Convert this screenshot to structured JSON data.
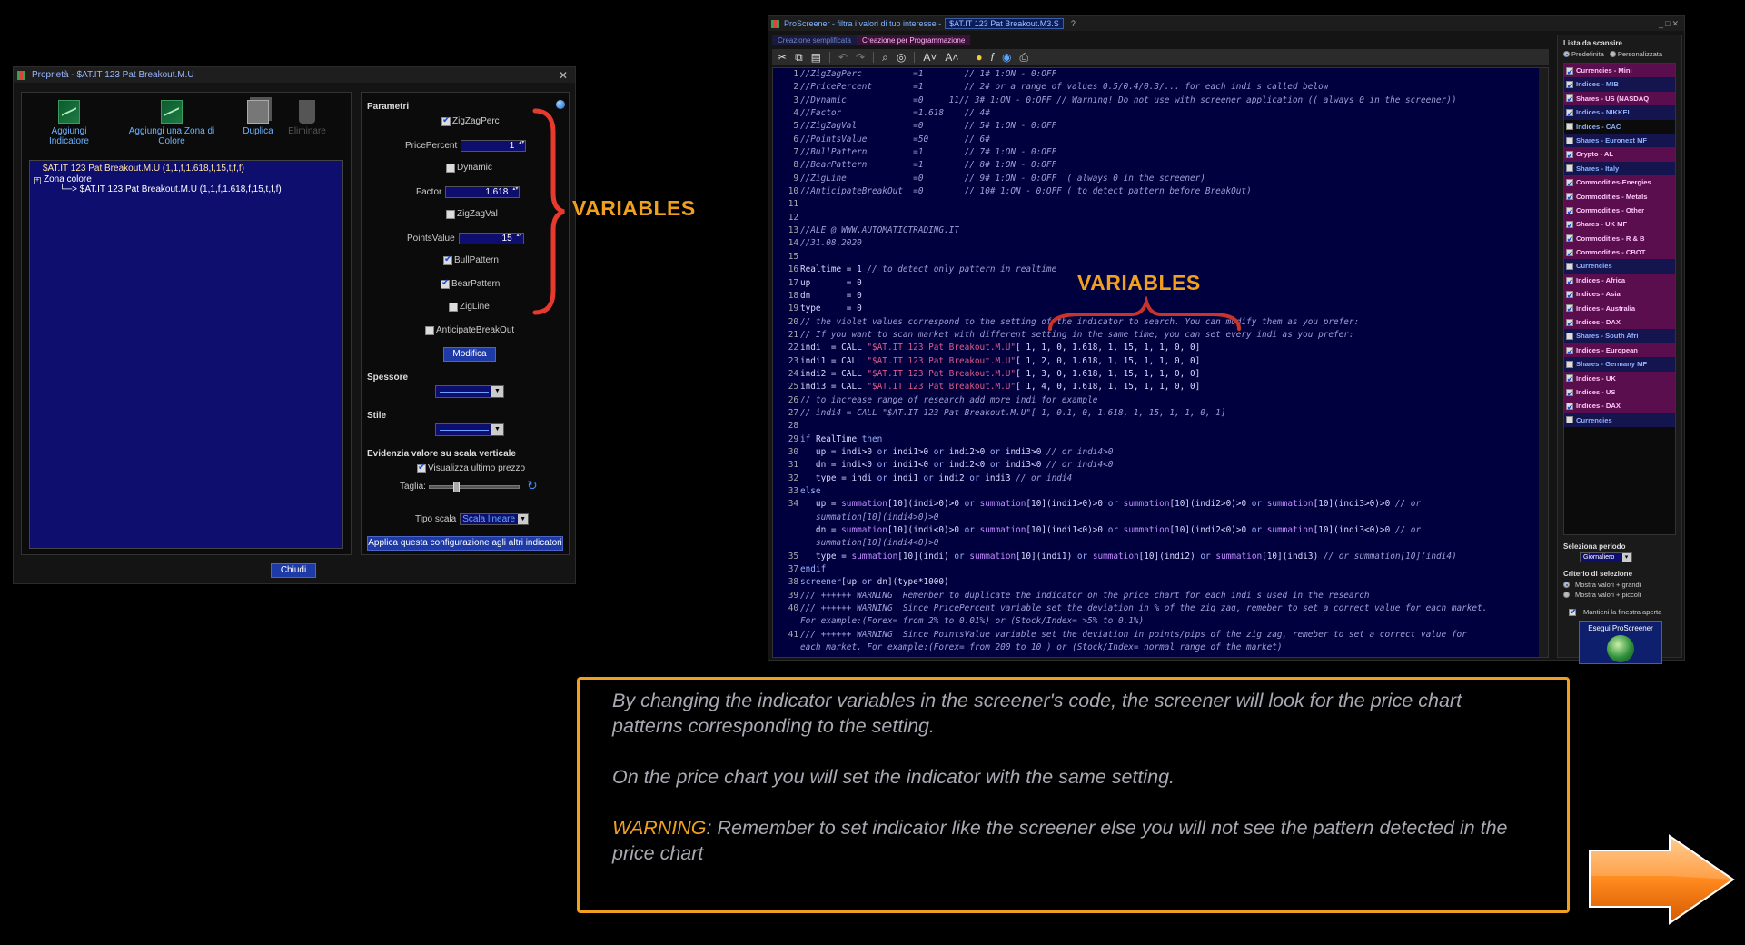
{
  "props_dialog": {
    "title": "Proprietà - $AT.IT 123 Pat Breakout.M.U",
    "toolbar": {
      "add_indicator": "Aggiungi Indicatore",
      "add_color_zone": "Aggiungi una Zona di Colore",
      "duplicate": "Duplica",
      "delete": "Eliminare"
    },
    "tree": {
      "root": "$AT.IT 123 Pat Breakout.M.U (1,1,f,1.618,f,15,t,f,f)",
      "zone": "Zona colore",
      "child": "$AT.IT 123 Pat Breakout.M.U (1,1,f,1.618,f,15,t,f,f)"
    },
    "params_title": "Parametri",
    "params": {
      "zigzagperc_label": "ZigZagPerc",
      "pricepercent_label": "PricePercent",
      "pricepercent_value": "1",
      "dynamic_label": "Dynamic",
      "factor_label": "Factor",
      "factor_value": "1.618",
      "zigzagval_label": "ZigZagVal",
      "pointsvalue_label": "PointsValue",
      "pointsvalue_value": "15",
      "bullpattern_label": "BullPattern",
      "bearpattern_label": "BearPattern",
      "zigline_label": "ZigLine",
      "anticipate_label": "AnticipateBreakOut"
    },
    "modify_button": "Modifica",
    "thickness_title": "Spessore",
    "style_title": "Stile",
    "highlight_title": "Evidenzia valore su scala verticale",
    "show_last_price": "Visualizza ultimo prezzo",
    "size_label": "Taglia:",
    "scale_type_label": "Tipo scala",
    "scale_type_value": "Scala lineare",
    "apply_button": "Applica questa configurazione agli altri indicatori",
    "close_button": "Chiudi"
  },
  "annotations": {
    "variables_left": "VARIABLES",
    "variables_code": "VARIABLES"
  },
  "screener": {
    "title": "ProScreener - filtra i valori di tuo interesse -",
    "title_tab": "$AT.IT 123 Pat Breakout.M3.S",
    "tab_simplified": "Creazione semplificata",
    "tab_programming": "Creazione per Programmazione",
    "code_lines": [
      {
        "n": "1",
        "html": "<span class='c-com'>//ZigZagPerc          =1        // 1# 1:ON - 0:OFF</span>"
      },
      {
        "n": "2",
        "html": "<span class='c-com'>//PricePercent        =1        // 2# or a range of values 0.5/0.4/0.3/... for each indi's called below</span>"
      },
      {
        "n": "3",
        "html": "<span class='c-com'>//Dynamic             =0     11// 3# 1:ON - 0:OFF // Warning! Do not use with screener application (( always 0 in the screener))</span>"
      },
      {
        "n": "4",
        "html": "<span class='c-com'>//Factor              =1.618    // 4#</span>"
      },
      {
        "n": "5",
        "html": "<span class='c-com'>//ZigZagVal           =0        // 5# 1:ON - 0:OFF</span>"
      },
      {
        "n": "6",
        "html": "<span class='c-com'>//PointsValue         =50       // 6#</span>"
      },
      {
        "n": "7",
        "html": "<span class='c-com'>//BullPattern         =1        // 7# 1:ON - 0:OFF</span>"
      },
      {
        "n": "8",
        "html": "<span class='c-com'>//BearPattern         =1        // 8# 1:ON - 0:OFF</span>"
      },
      {
        "n": "9",
        "html": "<span class='c-com'>//ZigLine             =0        // 9# 1:ON - 0:OFF  ( always 0 in the screener)</span>"
      },
      {
        "n": "10",
        "html": "<span class='c-com'>//AnticipateBreakOut  =0        // 10# 1:ON - 0:OFF ( to detect pattern before BreakOut)</span>"
      },
      {
        "n": "11",
        "html": ""
      },
      {
        "n": "12",
        "html": ""
      },
      {
        "n": "13",
        "html": "<span class='c-com'>//ALE @ WWW.AUTOMATICTRADING.IT</span>"
      },
      {
        "n": "14",
        "html": "<span class='c-com'>//31.08.2020</span>"
      },
      {
        "n": "15",
        "html": ""
      },
      {
        "n": "16",
        "html": "Realtime = 1 <span class='c-com'>// to detect only pattern in realtime</span>"
      },
      {
        "n": "17",
        "html": "up       = 0"
      },
      {
        "n": "18",
        "html": "dn       = 0"
      },
      {
        "n": "19",
        "html": "type     = 0"
      },
      {
        "n": "20",
        "html": "<span class='c-com'>// the violet values correspond to the setting of the indicator to search. You can modify them as you prefer:</span>"
      },
      {
        "n": "21",
        "html": "<span class='c-com'>// If you want to scan market with different setting in the same time, you can set every indi as you prefer:</span>"
      },
      {
        "n": "22",
        "html": "indi  = CALL <span class='c-str'>\"$AT.IT 123 Pat Breakout.M.U\"</span>[ 1, 1, 0, 1.618, 1, 15, 1, 1, 0, 0]"
      },
      {
        "n": "23",
        "html": "indi1 = CALL <span class='c-str'>\"$AT.IT 123 Pat Breakout.M.U\"</span>[ 1, 2, 0, 1.618, 1, 15, 1, 1, 0, 0]"
      },
      {
        "n": "24",
        "html": "indi2 = CALL <span class='c-str'>\"$AT.IT 123 Pat Breakout.M.U\"</span>[ 1, 3, 0, 1.618, 1, 15, 1, 1, 0, 0]"
      },
      {
        "n": "25",
        "html": "indi3 = CALL <span class='c-str'>\"$AT.IT 123 Pat Breakout.M.U\"</span>[ 1, 4, 0, 1.618, 1, 15, 1, 1, 0, 0]"
      },
      {
        "n": "26",
        "html": "<span class='c-com'>// to increase range of research add more indi for example</span>"
      },
      {
        "n": "27",
        "html": "<span class='c-com'>// indi4 = CALL \"$AT.IT 123 Pat Breakout.M.U\"[ 1, 0.1, 0, 1.618, 1, 15, 1, 1, 0, 1]</span>"
      },
      {
        "n": "28",
        "html": ""
      },
      {
        "n": "29",
        "html": "<span class='c-kw'>if</span> RealTime <span class='c-kw'>then</span>"
      },
      {
        "n": "30",
        "html": "   up = indi&gt;0 <span class='c-kw'>or</span> indi1&gt;0 <span class='c-kw'>or</span> indi2&gt;0 <span class='c-kw'>or</span> indi3&gt;0 <span class='c-com'>// or indi4&gt;0</span>"
      },
      {
        "n": "31",
        "html": "   dn = indi&lt;0 <span class='c-kw'>or</span> indi1&lt;0 <span class='c-kw'>or</span> indi2&lt;0 <span class='c-kw'>or</span> indi3&lt;0 <span class='c-com'>// or indi4&lt;0</span>"
      },
      {
        "n": "32",
        "html": "   type = indi <span class='c-kw'>or</span> indi1 <span class='c-kw'>or</span> indi2 <span class='c-kw'>or</span> indi3 <span class='c-com'>// or indi4</span>"
      },
      {
        "n": "33",
        "html": "<span class='c-kw'>else</span>"
      },
      {
        "n": "34",
        "html": "   up = <span class='c-fn'>summation</span>[10](indi&gt;0)&gt;0 <span class='c-kw'>or</span> <span class='c-fn'>summation</span>[10](indi1&gt;0)&gt;0 <span class='c-kw'>or</span> <span class='c-fn'>summation</span>[10](indi2&gt;0)&gt;0 <span class='c-kw'>or</span> <span class='c-fn'>summation</span>[10](indi3&gt;0)&gt;0 <span class='c-com'>// or</span>"
      },
      {
        "n": "",
        "html": "   <span class='c-com'>summation[10](indi4&gt;0)&gt;0</span>"
      },
      {
        "n": "",
        "html": "   dn = <span class='c-fn'>summation</span>[10](indi&lt;0)&gt;0 <span class='c-kw'>or</span> <span class='c-fn'>summation</span>[10](indi1&lt;0)&gt;0 <span class='c-kw'>or</span> <span class='c-fn'>summation</span>[10](indi2&lt;0)&gt;0 <span class='c-kw'>or</span> <span class='c-fn'>summation</span>[10](indi3&lt;0)&gt;0 <span class='c-com'>// or</span>"
      },
      {
        "n": "",
        "html": "   <span class='c-com'>summation[10](indi4&lt;0)&gt;0</span>"
      },
      {
        "n": "35",
        "html": "   type = <span class='c-fn'>summation</span>[10](indi) <span class='c-kw'>or</span> <span class='c-fn'>summation</span>[10](indi1) <span class='c-kw'>or</span> <span class='c-fn'>summation</span>[10](indi2) <span class='c-kw'>or</span> <span class='c-fn'>summation</span>[10](indi3) <span class='c-com'>// or summation[10](indi4)</span>"
      },
      {
        "n": "37",
        "html": "<span class='c-kw'>endif</span>"
      },
      {
        "n": "38",
        "html": "<span class='c-kw'>screener</span>[up <span class='c-kw'>or</span> dn](type*1000)"
      },
      {
        "n": "39",
        "html": "<span class='c-com'>/// ++++++ WARNING  Remenber to duplicate the indicator on the price chart for each indi's used in the research</span>"
      },
      {
        "n": "40",
        "html": "<span class='c-com'>/// ++++++ WARNING  Since PricePercent variable set the deviation in % of the zig zag, remeber to set a correct value for each market.</span>"
      },
      {
        "n": "",
        "html": "<span class='c-com'>For example:(Forex= from 2% to 0.01%) or (Stock/Index= &gt;5% to 0.1%)</span>"
      },
      {
        "n": "41",
        "html": "<span class='c-com'>/// ++++++ WARNING  Since PointsValue variable set the deviation in points/pips of the zig zag, remeber to set a correct value for</span>"
      },
      {
        "n": "",
        "html": "<span class='c-com'>each market. For example:(Forex= from 200 to 10 ) or (Stock/Index= normal range of the market)</span>"
      }
    ],
    "list_title": "Lista da scansire",
    "radio_predef": "Predefinita",
    "radio_custom": "Personalizzata",
    "list_items": [
      {
        "label": "Currencies - Mini",
        "style": "mag",
        "checked": true
      },
      {
        "label": "Indices - MIB",
        "style": "nav",
        "checked": true
      },
      {
        "label": "Shares - US (NASDAQ",
        "style": "mag",
        "checked": true
      },
      {
        "label": "Indices - NIKKEI",
        "style": "nav",
        "checked": true
      },
      {
        "label": "Indices - CAC",
        "style": "plain",
        "checked": false
      },
      {
        "label": "Shares - Euronext MF",
        "style": "nav",
        "checked": false
      },
      {
        "label": "Crypto - AL",
        "style": "mag",
        "checked": true
      },
      {
        "label": "Shares - Italy",
        "style": "nav",
        "checked": false
      },
      {
        "label": "Commodities-Energies",
        "style": "mag",
        "checked": true
      },
      {
        "label": "Commodities - Metals",
        "style": "mag",
        "checked": true
      },
      {
        "label": "Commodities - Other",
        "style": "mag",
        "checked": true
      },
      {
        "label": "Shares - UK MF",
        "style": "mag",
        "checked": true
      },
      {
        "label": "Commodities - R & B",
        "style": "mag",
        "checked": true
      },
      {
        "label": "Commodities - CBOT",
        "style": "mag",
        "checked": true
      },
      {
        "label": "Currencies",
        "style": "nav",
        "checked": false
      },
      {
        "label": "Indices - Africa",
        "style": "mag",
        "checked": true
      },
      {
        "label": "Indices - Asia",
        "style": "mag",
        "checked": true
      },
      {
        "label": "Indices - Australia",
        "style": "mag",
        "checked": true
      },
      {
        "label": "Indices - DAX",
        "style": "mag",
        "checked": true
      },
      {
        "label": "Shares - South Afri",
        "style": "nav",
        "checked": false
      },
      {
        "label": "Indices - European",
        "style": "mag",
        "checked": true
      },
      {
        "label": "Shares - Germany MF",
        "style": "nav",
        "checked": false
      },
      {
        "label": "Indices - UK",
        "style": "mag",
        "checked": true
      },
      {
        "label": "Indices - US",
        "style": "mag",
        "checked": true
      },
      {
        "label": "Indices - DAX",
        "style": "mag",
        "checked": true
      },
      {
        "label": "Currencies",
        "style": "nav",
        "checked": false
      }
    ],
    "period_title": "Seleziona periodo",
    "period_value": "Giornaliero",
    "criteria_title": "Criterio di selezione",
    "criteria_bigger": "Mostra valori + grandi",
    "criteria_smaller": "Mostra valori + piccoli",
    "keep_open": "Mantieni la finestra aperta",
    "run_button": "Esegui ProScreener"
  },
  "info_box": {
    "p1": "By changing the indicator variables in the screener's code, the screener will look for the price chart  patterns corresponding to the setting.",
    "p2": "On the price chart you will set the indicator with the same setting.",
    "warning_word": "WARNING",
    "p3_rest": ": Remember to set indicator like the screener else you will not see the pattern detected in the price chart"
  },
  "colors": {
    "accent_orange": "#f0a01e",
    "brace_red": "#e8392e",
    "editor_bg": "#00003e"
  }
}
